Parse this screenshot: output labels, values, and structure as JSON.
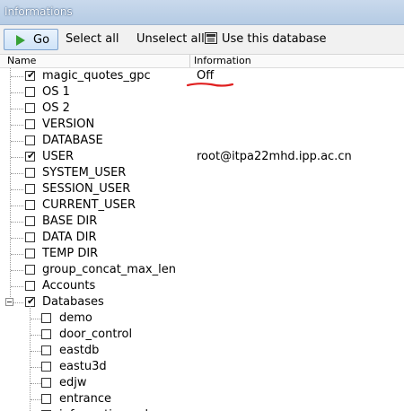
{
  "window": {
    "title": "Informations"
  },
  "toolbar": {
    "go_label": "Go",
    "select_all_label": "Select all",
    "unselect_all_label": "Unselect all",
    "use_db_label": "Use this database"
  },
  "columns": {
    "name": "Name",
    "information": "Information"
  },
  "items": [
    {
      "name": "magic_quotes_gpc",
      "checked": true,
      "value": "Off"
    },
    {
      "name": "OS 1",
      "checked": false,
      "value": ""
    },
    {
      "name": "OS 2",
      "checked": false,
      "value": ""
    },
    {
      "name": "VERSION",
      "checked": false,
      "value": ""
    },
    {
      "name": "DATABASE",
      "checked": false,
      "value": ""
    },
    {
      "name": "USER",
      "checked": true,
      "value": "root@itpa22mhd.ipp.ac.cn"
    },
    {
      "name": "SYSTEM_USER",
      "checked": false,
      "value": ""
    },
    {
      "name": "SESSION_USER",
      "checked": false,
      "value": ""
    },
    {
      "name": "CURRENT_USER",
      "checked": false,
      "value": ""
    },
    {
      "name": "BASE DIR",
      "checked": false,
      "value": ""
    },
    {
      "name": "DATA DIR",
      "checked": false,
      "value": ""
    },
    {
      "name": "TEMP DIR",
      "checked": false,
      "value": ""
    },
    {
      "name": "group_concat_max_len",
      "checked": false,
      "value": ""
    },
    {
      "name": "Accounts",
      "checked": false,
      "value": ""
    },
    {
      "name": "Databases",
      "checked": true,
      "value": "",
      "expanded": true
    }
  ],
  "databases": [
    "demo",
    "door_control",
    "eastdb",
    "eastu3d",
    "edjw",
    "entrance",
    "information_schema"
  ],
  "annotation": {
    "color": "#e02020"
  }
}
